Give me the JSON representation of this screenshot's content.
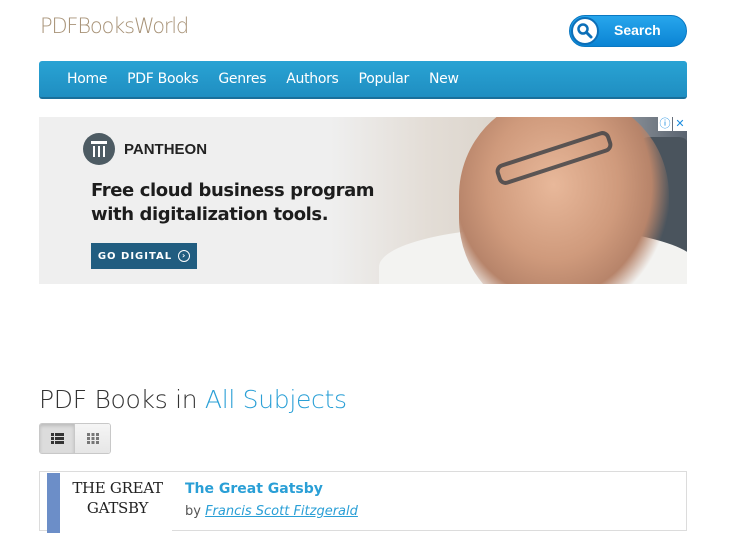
{
  "header": {
    "logo": "PDFBooksWorld",
    "search_label": "Search"
  },
  "nav": {
    "items": [
      "Home",
      "PDF Books",
      "Genres",
      "Authors",
      "Popular",
      "New"
    ]
  },
  "ad": {
    "brand": "PANTHEON",
    "headline_line1": "Free cloud business program",
    "headline_line2": "with digitalization tools.",
    "cta": "GO DIGITAL",
    "info_icon": "ⓘ",
    "close_icon": "✕"
  },
  "main": {
    "title_prefix": "PDF Books in ",
    "title_subject": "All Subjects",
    "view_modes": [
      "list",
      "grid"
    ],
    "active_view": "list"
  },
  "books": [
    {
      "cover_line1": "THE GREAT",
      "cover_line2": "GATSBY",
      "title": "The Great Gatsby",
      "by": "by ",
      "author": "Francis Scott Fitzgerald"
    }
  ]
}
